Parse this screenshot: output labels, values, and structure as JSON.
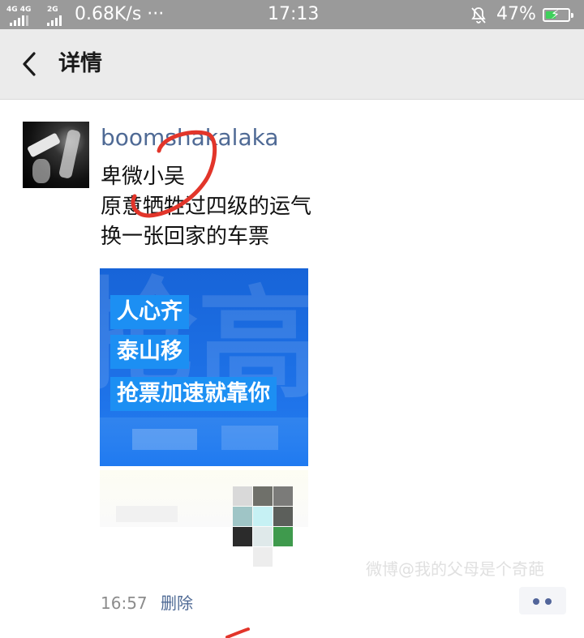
{
  "status_bar": {
    "signal_1": "4G 4G",
    "signal_2": "2G",
    "network_speed": "0.68K/s ···",
    "time": "17:13",
    "mute_icon": "bell-muted-icon",
    "battery_percent": "47%",
    "battery_level": 0.47,
    "battery_color": "#3ed05b"
  },
  "header": {
    "back_icon": "chevron-left-icon",
    "title": "详情"
  },
  "post": {
    "username": "boomshakalaka",
    "text_lines": [
      "卑微小吴",
      "原意牺牲过四级的运气",
      "换一张回家的车票"
    ],
    "image": {
      "lines": [
        "人心齐",
        "泰山移",
        "抢票加速就靠你"
      ],
      "background_color": "#1a6be0"
    },
    "time": "16:57",
    "delete_label": "删除",
    "more_icon": "more-dots-icon"
  },
  "watermark": "微博@我的父母是个奇葩",
  "colors": {
    "link": "#4f6a95",
    "annotation_red": "#e2352a"
  }
}
